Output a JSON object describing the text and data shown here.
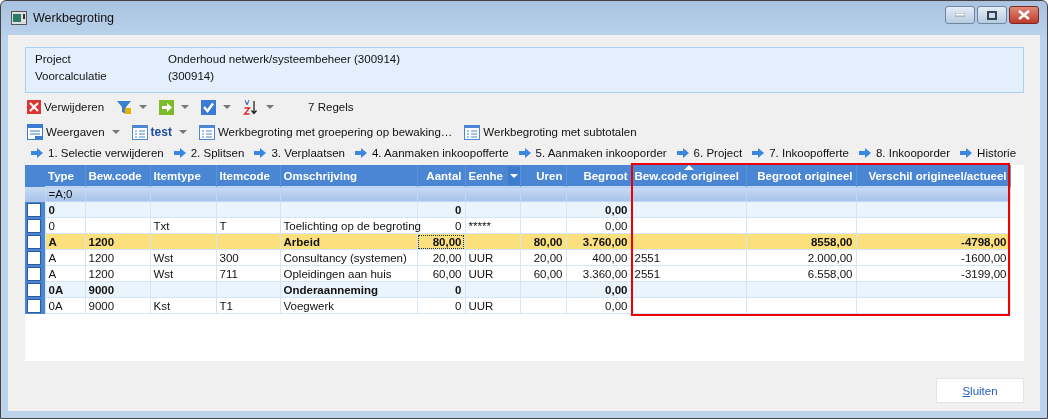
{
  "window": {
    "title": "Werkbegroting"
  },
  "info": [
    {
      "label": "Project",
      "value": "Onderhoud netwerk/systeembeheer (300914)"
    },
    {
      "label": "Voorcalculatie",
      "value": "(300914)"
    }
  ],
  "toolbar": {
    "buttons": [
      {
        "kind": "delete",
        "label": "Verwijderen",
        "dropdown": false
      },
      {
        "kind": "filter",
        "dropdown": true
      },
      {
        "kind": "go",
        "dropdown": true
      },
      {
        "kind": "check",
        "dropdown": true
      },
      {
        "kind": "sort",
        "dropdown": true
      }
    ],
    "count": "7 Regels"
  },
  "views": {
    "menu": "Weergaven",
    "items": [
      {
        "label": "test",
        "selected": true,
        "dropdown": true
      },
      {
        "label": "Werkbegroting met groepering op bewaking…",
        "selected": false,
        "dropdown": false
      },
      {
        "label": "Werkbegroting met subtotalen",
        "selected": false,
        "dropdown": false
      }
    ]
  },
  "actions": [
    "1. Selectie verwijderen",
    "2. Splitsen",
    "3. Verplaatsen",
    "4. Aanmaken inkoopofferte",
    "5. Aanmaken inkooporder",
    "6. Project",
    "7. Inkoopofferte",
    "8. Inkooporder",
    "Historie"
  ],
  "table": {
    "columns": [
      {
        "label": "Type",
        "sorted": false,
        "filter": false,
        "highlighted": false
      },
      {
        "label": "Bew.code",
        "sorted": false,
        "filter": false,
        "highlighted": false
      },
      {
        "label": "Itemtype",
        "sorted": false,
        "filter": false,
        "highlighted": false
      },
      {
        "label": "Itemcode",
        "sorted": false,
        "filter": false,
        "highlighted": false
      },
      {
        "label": "Omschrijving",
        "sorted": false,
        "filter": false,
        "highlighted": false
      },
      {
        "label": "Aantal",
        "sorted": false,
        "filter": false,
        "highlighted": false
      },
      {
        "label": "Eenhe",
        "sorted": false,
        "filter": true,
        "highlighted": false
      },
      {
        "label": "Uren",
        "sorted": false,
        "filter": false,
        "highlighted": false
      },
      {
        "label": "Begroot",
        "sorted": false,
        "filter": false,
        "highlighted": false
      },
      {
        "label": "Bew.code origineel",
        "sorted": true,
        "filter": false,
        "highlighted": true
      },
      {
        "label": "Begroot origineel",
        "sorted": false,
        "filter": false,
        "highlighted": true
      },
      {
        "label": "Verschil origineel/actueel",
        "sorted": false,
        "filter": false,
        "highlighted": true
      }
    ],
    "filter_value": "=A;0",
    "rows": [
      {
        "kind": "group",
        "checked": false,
        "selected": false,
        "cells": [
          "0",
          null,
          null,
          null,
          null,
          "0",
          null,
          null,
          "0,00",
          null,
          null,
          null
        ]
      },
      {
        "kind": "item",
        "checked": false,
        "selected": false,
        "cells": [
          "0",
          null,
          "Txt",
          "T",
          "Toelichting op de begroting",
          "0",
          "*****",
          null,
          "0,00",
          null,
          null,
          null
        ]
      },
      {
        "kind": "group",
        "checked": false,
        "selected": true,
        "cells": [
          "A",
          "1200",
          null,
          null,
          "Arbeid",
          "80,00",
          null,
          "80,00",
          "3.760,00",
          null,
          "8558,00",
          "-4798,00"
        ]
      },
      {
        "kind": "item",
        "checked": false,
        "selected": false,
        "cells": [
          "A",
          "1200",
          "Wst",
          "300",
          "Consultancy (systemen)",
          "20,00",
          "UUR",
          "20,00",
          "400,00",
          "2551",
          "2.000,00",
          "-1600,00"
        ]
      },
      {
        "kind": "item",
        "checked": false,
        "selected": false,
        "cells": [
          "A",
          "1200",
          "Wst",
          "711",
          "Opleidingen aan huis",
          "60,00",
          "UUR",
          "60,00",
          "3.360,00",
          "2551",
          "6.558,00",
          "-3199,00"
        ]
      },
      {
        "kind": "group",
        "checked": false,
        "selected": false,
        "cells": [
          "0A",
          "9000",
          null,
          null,
          "Onderaanneming",
          "0",
          null,
          null,
          "0,00",
          null,
          null,
          null
        ]
      },
      {
        "kind": "item",
        "checked": false,
        "selected": false,
        "cells": [
          "0A",
          "9000",
          "Kst",
          "T1",
          "Voegwerk",
          "0",
          "UUR",
          null,
          "0,00",
          null,
          null,
          null
        ]
      }
    ]
  },
  "buttons": [
    "Sluiten"
  ]
}
